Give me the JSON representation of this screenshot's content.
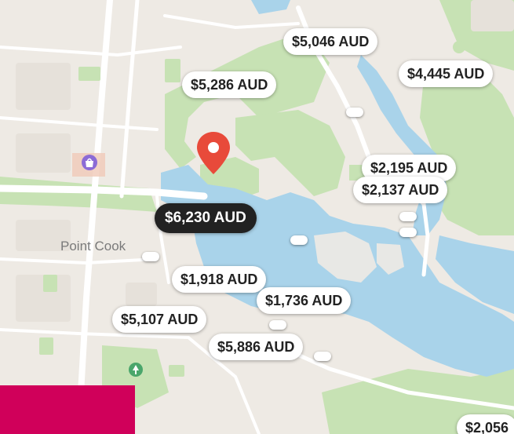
{
  "map": {
    "place_label": "Point Cook",
    "colors": {
      "water": "#a9d3ea",
      "park": "#c7e2b4",
      "land": "#eeeae4",
      "accent": "#d0005a",
      "pin": "#e84a3a"
    },
    "icons": {
      "pin": "location-pin-icon",
      "poi_purple": "shopping-poi-icon",
      "poi_green": "park-poi-icon"
    }
  },
  "listings": [
    {
      "price": "$5,046 AUD"
    },
    {
      "price": "$4,445 AUD"
    },
    {
      "price": "$5,286 AUD"
    },
    {
      "price": "$2,195 AUD"
    },
    {
      "price": "$2,137 AUD"
    },
    {
      "price": "$6,230 AUD",
      "selected": true
    },
    {
      "price": "$1,918 AUD"
    },
    {
      "price": "$1,736 AUD"
    },
    {
      "price": "$5,107 AUD"
    },
    {
      "price": "$5,886 AUD"
    },
    {
      "price": "$2,056"
    }
  ]
}
